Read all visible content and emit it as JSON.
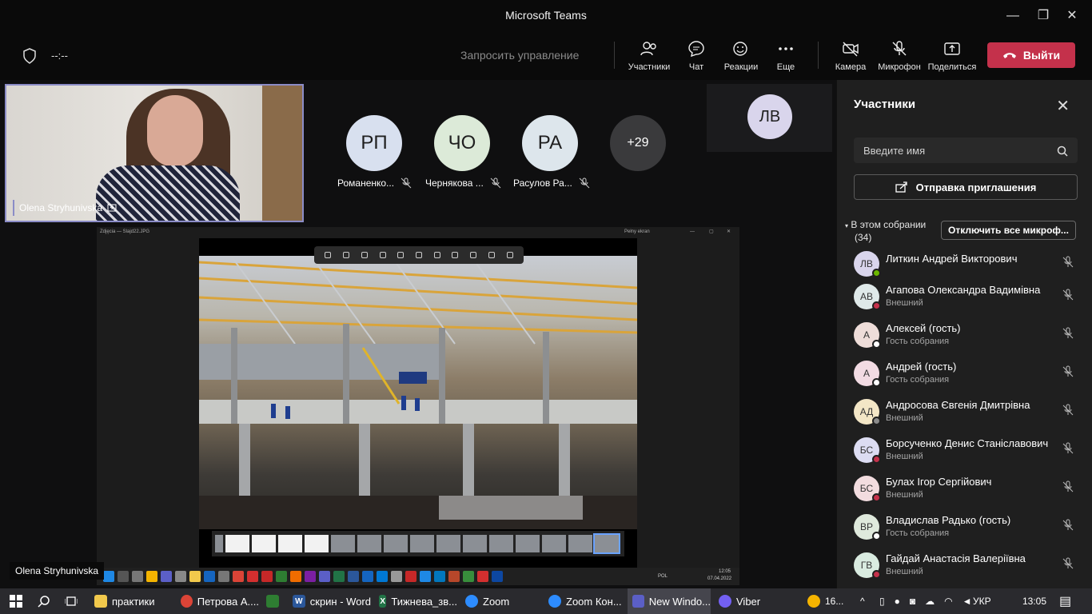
{
  "window": {
    "title": "Microsoft Teams",
    "minimize": "—",
    "restore": "❐",
    "close": "✕"
  },
  "toolbar": {
    "timer": "--:--",
    "request_control": "Запросить управление",
    "participants": "Участники",
    "chat": "Чат",
    "reactions": "Реакции",
    "more": "Еще",
    "camera": "Камера",
    "mic": "Микрофон",
    "share": "Поделиться",
    "leave": "Выйти"
  },
  "stage": {
    "selfview_name": "Olena Stryhunivska",
    "tiles": [
      {
        "initials": "РП",
        "name": "Романенко...",
        "color": "#d8e0ef"
      },
      {
        "initials": "ЧО",
        "name": "Чернякова ...",
        "color": "#dcead8"
      },
      {
        "initials": "РА",
        "name": "Расулов Ра...",
        "color": "#dde6ec"
      }
    ],
    "overflow": "+29",
    "speaker_tile": "ЛВ",
    "presenter_name": "Olena Stryhunivska"
  },
  "shared_screen": {
    "window_title": "Zdjęcia — Slajd22.JPG",
    "fullscreen_label": "Pełny ekran",
    "win_min": "—",
    "win_max": "▢",
    "win_close": "✕",
    "lang": "POL",
    "time": "12:05",
    "date": "07.04.2022"
  },
  "panel": {
    "title": "Участники",
    "search_placeholder": "Введите имя",
    "invite": "Отправка приглашения",
    "section_label": "В этом собрании",
    "section_count": "(34)",
    "mute_all": "Отключить все микроф...",
    "people": [
      {
        "initials": "ЛВ",
        "name": "Литкин Андрей Викторович",
        "status": "",
        "avatar": "#d9d5ec",
        "dot": "#6bb700"
      },
      {
        "initials": "АВ",
        "name": "Агапова Олександра Вадимівна",
        "status": "Внешний",
        "avatar": "#dfe9e9",
        "dot": "#c4314b"
      },
      {
        "initials": "А",
        "name": "Алексей (гость)",
        "status": "Гость собрания",
        "avatar": "#eeddd9",
        "dot": "#ffffff"
      },
      {
        "initials": "А",
        "name": "Андрей (гость)",
        "status": "Гость собрания",
        "avatar": "#f2dbe3",
        "dot": "#ffffff"
      },
      {
        "initials": "АД",
        "name": "Андросова Євгенія Дмитрівна",
        "status": "Внешний",
        "avatar": "#f3e6c6",
        "dot": "#8a8a8a"
      },
      {
        "initials": "БС",
        "name": "Борсученко Денис Станіславович",
        "status": "Внешний",
        "avatar": "#dcdcf2",
        "dot": "#c4314b"
      },
      {
        "initials": "БС",
        "name": "Булах Ігор Сергійович",
        "status": "Внешний",
        "avatar": "#f2dcdf",
        "dot": "#c4314b"
      },
      {
        "initials": "ВР",
        "name": "Владислав Радько (гость)",
        "status": "Гость собрания",
        "avatar": "#dfe9dc",
        "dot": "#ffffff"
      },
      {
        "initials": "ГВ",
        "name": "Гайдай Анастасія Валеріївна",
        "status": "Внешний",
        "avatar": "#d9ebe0",
        "dot": "#c4314b"
      }
    ]
  },
  "taskbar": {
    "items": [
      {
        "label": "практики",
        "icon": "",
        "color": "#f2c94c"
      },
      {
        "label": "Петрова А....",
        "icon": "",
        "color": "#db4437"
      },
      {
        "label": "",
        "icon": "",
        "color": "#2e7d32"
      },
      {
        "label": "скрин - Word",
        "icon": "W",
        "color": "#2b579a"
      },
      {
        "label": "Тижнева_зв...",
        "icon": "X",
        "color": "#217346"
      },
      {
        "label": "Zoom",
        "icon": "",
        "color": "#2d8cff"
      },
      {
        "label": "Zoom Кон...",
        "icon": "",
        "color": "#2d8cff"
      },
      {
        "label": "New Windo...",
        "icon": "",
        "color": "#5b5fc7"
      },
      {
        "label": "Viber",
        "icon": "",
        "color": "#7360f2"
      }
    ],
    "weather": "16...",
    "lang": "УКР",
    "time": "13:05"
  }
}
